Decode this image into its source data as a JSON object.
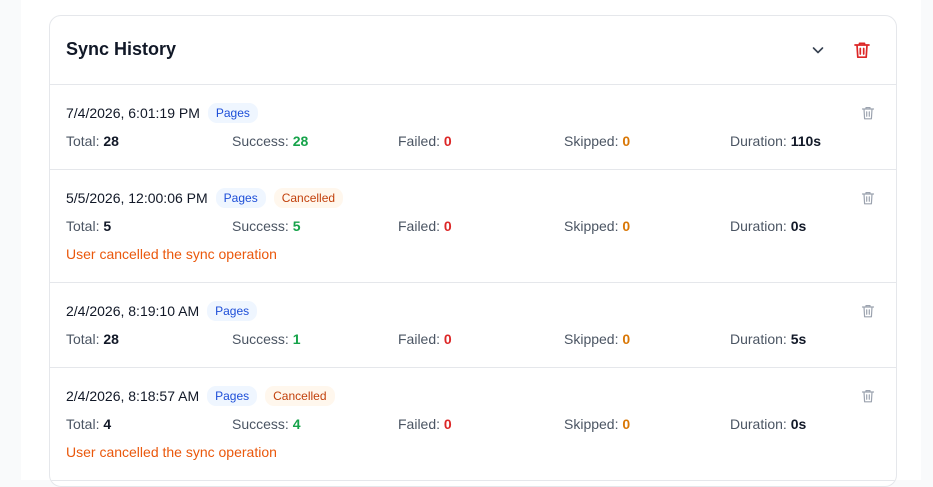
{
  "card": {
    "title": "Sync History"
  },
  "labels": {
    "total": "Total:",
    "success": "Success:",
    "failed": "Failed:",
    "skipped": "Skipped:",
    "duration": "Duration:"
  },
  "entries": [
    {
      "timestamp": "7/4/2026, 6:01:19 PM",
      "type": "Pages",
      "status": "",
      "total": "28",
      "success": "28",
      "failed": "0",
      "skipped": "0",
      "duration": "110s",
      "message": ""
    },
    {
      "timestamp": "5/5/2026, 12:00:06 PM",
      "type": "Pages",
      "status": "Cancelled",
      "total": "5",
      "success": "5",
      "failed": "0",
      "skipped": "0",
      "duration": "0s",
      "message": "User cancelled the sync operation"
    },
    {
      "timestamp": "2/4/2026, 8:19:10 AM",
      "type": "Pages",
      "status": "",
      "total": "28",
      "success": "1",
      "failed": "0",
      "skipped": "0",
      "duration": "5s",
      "message": ""
    },
    {
      "timestamp": "2/4/2026, 8:18:57 AM",
      "type": "Pages",
      "status": "Cancelled",
      "total": "4",
      "success": "4",
      "failed": "0",
      "skipped": "0",
      "duration": "0s",
      "message": "User cancelled the sync operation"
    }
  ],
  "icons": {
    "collapse": "chevron-down-icon",
    "delete_all": "trash-icon",
    "delete_row": "trash-icon"
  },
  "colors": {
    "success": "#16a34a",
    "failed": "#dc2626",
    "skipped": "#d97706",
    "cancel_text": "#ea580c",
    "delete_accent": "#dc2626",
    "type_badge_bg": "#eff6ff",
    "type_badge_fg": "#1d4ed8",
    "cancel_badge_bg": "#fff7ed",
    "cancel_badge_fg": "#c2410c"
  }
}
